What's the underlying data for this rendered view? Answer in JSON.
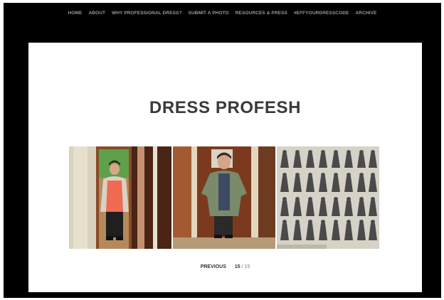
{
  "nav": {
    "items": [
      {
        "label": "HOME"
      },
      {
        "label": "ABOUT"
      },
      {
        "label": "WHY PROFESSIONAL DRESS?"
      },
      {
        "label": "SUBMIT A PHOTO"
      },
      {
        "label": "RESOURCES & PRESS"
      },
      {
        "label": "#EFFYOURDRESSCODE"
      },
      {
        "label": "ARCHIVE"
      }
    ]
  },
  "site": {
    "title": "DRESS PROFESH"
  },
  "gallery": {
    "photos": [
      {
        "name": "photo-woman-coral-top"
      },
      {
        "name": "photo-woman-green-cardigan"
      },
      {
        "name": "photo-historical-costume-engraving"
      }
    ]
  },
  "pagination": {
    "previous_label": "PREVIOUS",
    "current": "15",
    "separator": "/",
    "total": "15"
  },
  "colors": {
    "frame_background": "#000000",
    "card_background": "#ffffff",
    "nav_text": "#9a9a9a",
    "title_text": "#3a3a3a"
  }
}
